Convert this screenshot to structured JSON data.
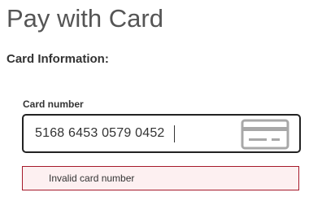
{
  "header": {
    "title": "Pay with Card"
  },
  "section": {
    "title": "Card Information:"
  },
  "card_number": {
    "label": "Card number",
    "value": "5168 6453 0579 0452",
    "icon": "credit-card-icon"
  },
  "error": {
    "message": "Invalid card number"
  },
  "colors": {
    "error_border": "#a61a2b",
    "error_background": "#fdf0f1",
    "input_border": "#222222"
  }
}
